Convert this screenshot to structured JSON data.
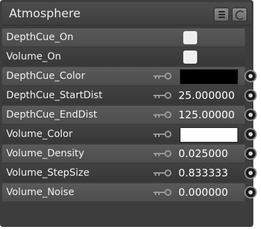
{
  "panel": {
    "title": "Atmosphere",
    "menu_icon": "menu-lines-icon",
    "refresh_icon": "refresh-icon"
  },
  "rows": [
    {
      "label": "DepthCue_On",
      "type": "toggle",
      "checked": true
    },
    {
      "label": "Volume_On",
      "type": "toggle",
      "checked": true
    },
    {
      "label": "DepthCue_Color",
      "type": "color",
      "color": "#000000"
    },
    {
      "label": "DepthCue_StartDist",
      "type": "number",
      "value": "25.000000"
    },
    {
      "label": "DepthCue_EndDist",
      "type": "number",
      "value": "125.00000"
    },
    {
      "label": "Volume_Color",
      "type": "color",
      "color": "#ffffff"
    },
    {
      "label": "Volume_Density",
      "type": "number",
      "value": "0.025000"
    },
    {
      "label": "Volume_StepSize",
      "type": "number",
      "value": "0.833333"
    },
    {
      "label": "Volume_Noise",
      "type": "number",
      "value": "0.000000"
    }
  ]
}
